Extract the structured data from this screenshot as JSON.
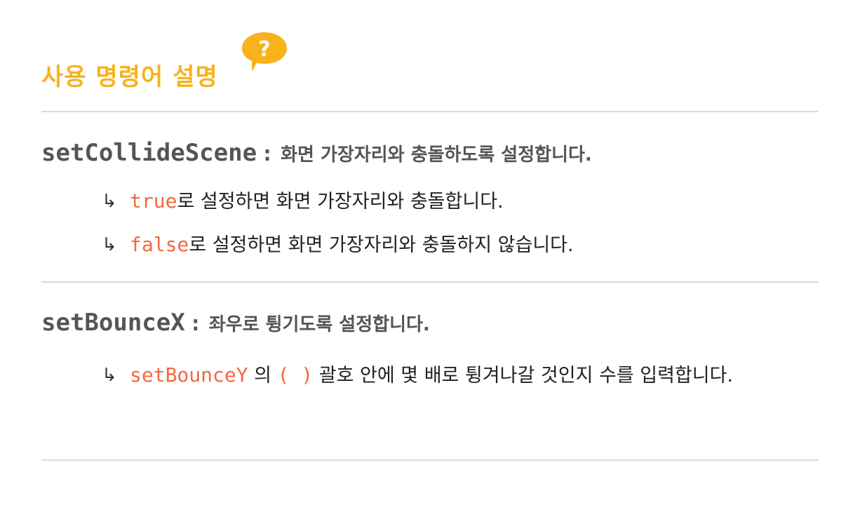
{
  "header": {
    "title": "사용 명령어 설명",
    "help_badge": "?"
  },
  "commands": [
    {
      "name": "setCollideScene",
      "colon": ":",
      "description": "화면 가장자리와 충돌하도록 설정합니다.",
      "bullets": [
        {
          "arrow": "↳",
          "code": "true",
          "text": "로 설정하면 화면 가장자리와 충돌합니다."
        },
        {
          "arrow": "↳",
          "code": "false",
          "text": "로 설정하면 화면 가장자리와 충돌하지 않습니다."
        }
      ]
    },
    {
      "name": "setBounceX",
      "colon": ":",
      "description": "좌우로 튕기도록 설정합니다.",
      "bullets": [
        {
          "arrow": "↳",
          "code": "setBounceY",
          "mid": " 의 ",
          "code2": "( )",
          "text": " 괄호 안에 몇 배로 튕겨나갈 것인지 수를 입력합니다."
        }
      ]
    }
  ],
  "colors": {
    "title": "#f7b21c",
    "code": "#f4683f",
    "command": "#555555",
    "divider": "#d9d9d9"
  }
}
